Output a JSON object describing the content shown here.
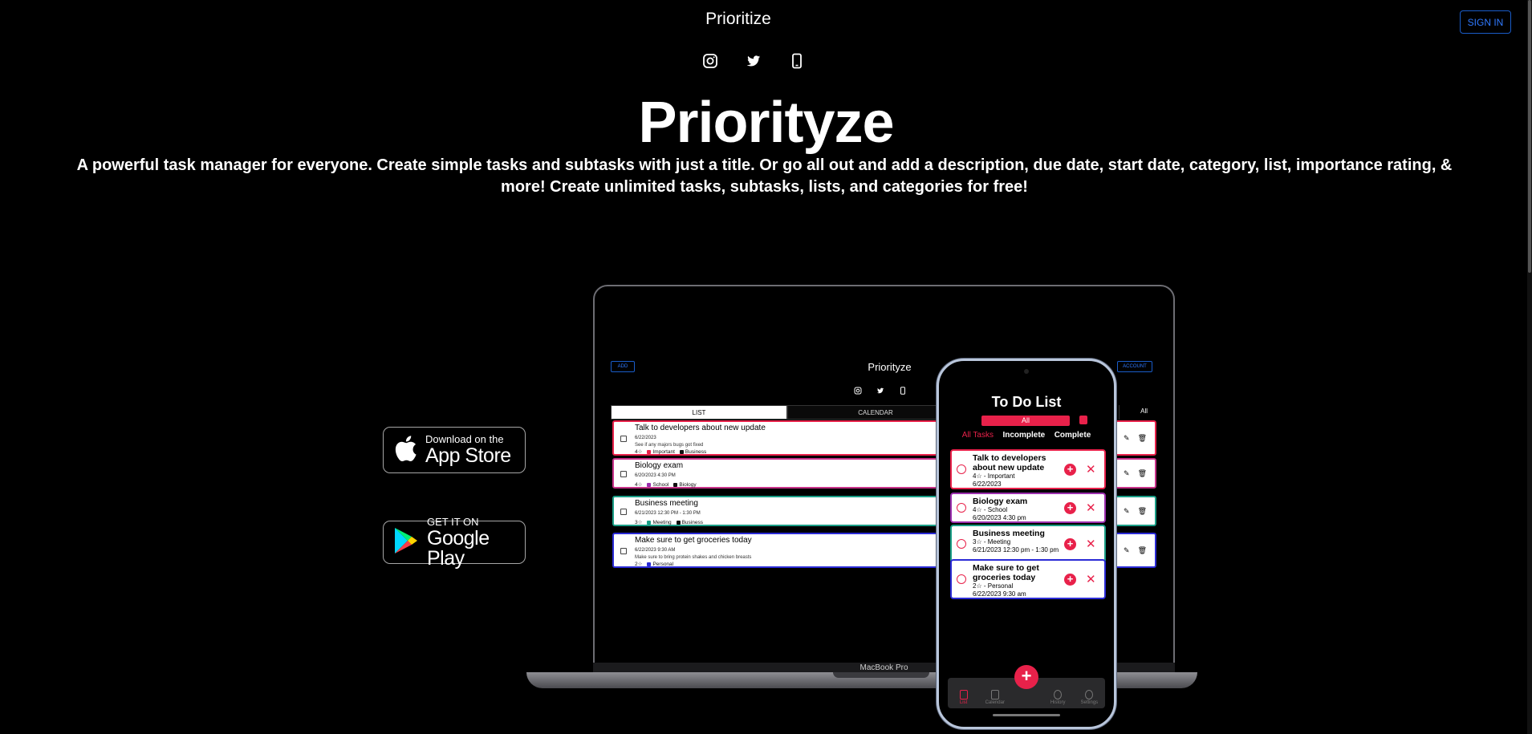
{
  "header": {
    "brand": "Prioritize",
    "sign_in": "SIGN IN",
    "socials": [
      "instagram-icon",
      "twitter-icon",
      "phone-icon"
    ]
  },
  "hero": {
    "title": "Priorityze",
    "description": "A powerful task manager for everyone. Create simple tasks and subtasks with just a title. Or go all out and add a description, due date, start date, category, list, importance rating, & more! Create unlimited tasks, subtasks, lists, and categories for free!"
  },
  "badges": {
    "apple": {
      "small": "Download on the",
      "big": "App Store"
    },
    "google": {
      "small": "GET IT ON",
      "big": "Google Play"
    }
  },
  "laptop": {
    "label": "MacBook Pro",
    "add": "ADD",
    "account": "ACCOUNT",
    "title": "Priorityze",
    "tabs": [
      "LIST",
      "CALENDAR"
    ],
    "filter_all": "All",
    "tasks": [
      {
        "title": "Talk to developers about new update",
        "date": "6/22/2023",
        "note": "See if any majors bugs got fixed",
        "rating": "4☆",
        "tags": [
          {
            "name": "Important",
            "color": "#e8214a"
          },
          {
            "name": "Business",
            "color": "#111111"
          }
        ],
        "border": "#e8214a"
      },
      {
        "title": "Biology exam",
        "date": "6/20/2023 4:30 PM",
        "note": "",
        "rating": "4☆",
        "tags": [
          {
            "name": "School",
            "color": "#9b2fae"
          },
          {
            "name": "Biology",
            "color": "#111111"
          }
        ],
        "border": "#c8338a"
      },
      {
        "title": "Business meeting",
        "date": "6/21/2023 12:30 PM - 1:30 PM",
        "note": "",
        "rating": "3☆",
        "tags": [
          {
            "name": "Meeting",
            "color": "#1a9e86"
          },
          {
            "name": "Business",
            "color": "#111111"
          }
        ],
        "border": "#1a9e86"
      },
      {
        "title": "Make sure to get groceries today",
        "date": "6/22/2023 9:30 AM",
        "note": "Make sure to bring protein shakes and chicken breasts",
        "rating": "2☆",
        "tags": [
          {
            "name": "Personal",
            "color": "#2b2bd6"
          }
        ],
        "border": "#2b2bd6"
      }
    ]
  },
  "phone": {
    "title": "To Do List",
    "segment": "All",
    "filters": [
      "All Tasks",
      "Incomplete",
      "Complete"
    ],
    "tasks": [
      {
        "title": "Talk to developers about new update",
        "meta1": "4☆ - Important",
        "meta2": "6/22/2023",
        "border": "#e8214a"
      },
      {
        "title": "Biology exam",
        "meta1": "4☆ - School",
        "meta2": "6/20/2023 4:30 pm",
        "border": "#9b2fae"
      },
      {
        "title": "Business meeting",
        "meta1": "3☆ - Meeting",
        "meta2": "6/21/2023 12:30 pm - 1:30 pm",
        "border": "#1a9e86"
      },
      {
        "title": "Make sure to get groceries today",
        "meta1": "2☆ - Personal",
        "meta2": "6/22/2023 9:30 am",
        "border": "#2b2bd6"
      }
    ],
    "nav": [
      "List",
      "Calendar",
      "History",
      "Settings"
    ],
    "fab": "+"
  },
  "colors": {
    "accent": "#e8214a",
    "link_blue": "#2f79ff"
  }
}
